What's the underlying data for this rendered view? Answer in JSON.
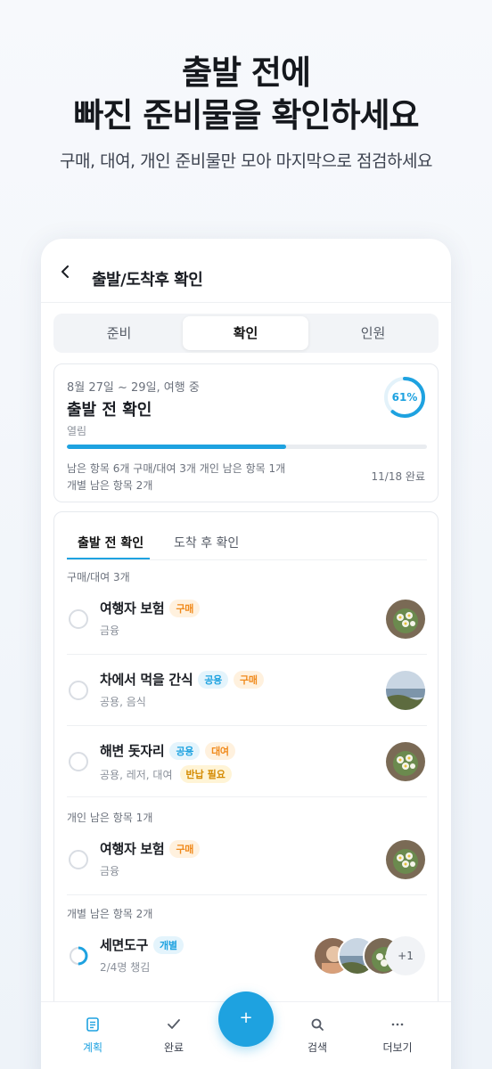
{
  "hero": {
    "title_line1": "출발 전에",
    "title_line2": "빠진 준비물을 확인하세요",
    "subtitle": "구매, 대여, 개인 준비물만 모아 마지막으로 점검하세요"
  },
  "header": {
    "title": "출발/도착후 확인",
    "back_icon": "chevron-left-icon"
  },
  "segments": {
    "items": [
      "준비",
      "확인",
      "인원"
    ],
    "active": "확인"
  },
  "summary": {
    "dates": "8월 27일 ~ 29일, 여행 중",
    "title": "출발 전 확인",
    "status": "열림",
    "progress_label": "61%",
    "progress": 0.61,
    "meta_line1": "남은 항목 6개  구매/대여 3개  개인 남은 항목 1개",
    "meta_line2": "개별 남은 항목 2개",
    "done": "11/18 완료"
  },
  "subtabs": [
    "출발 전 확인",
    "도착 후 확인"
  ],
  "sections": [
    {
      "label": "구매/대여 3개"
    },
    {
      "label": "개인 남은 항목 1개"
    },
    {
      "label": "개별 남은 항목 2개"
    }
  ],
  "items": [
    {
      "name": "여행자 보험",
      "tags": [
        "구매"
      ],
      "sub": "금융",
      "sub_tag": ""
    },
    {
      "name": "차에서 먹을 간식",
      "tags": [
        "공용",
        "구매"
      ],
      "sub": "공용, 음식",
      "sub_tag": ""
    },
    {
      "name": "해변 돗자리",
      "tags": [
        "공용",
        "대여"
      ],
      "sub": "공용, 레저, 대여",
      "sub_tag": "반납 필요"
    },
    {
      "name": "여행자 보험",
      "tags": [
        "구매"
      ],
      "sub": "금융",
      "sub_tag": ""
    },
    {
      "name": "세면도구",
      "tags": [
        "개별"
      ],
      "sub": "2/4명 챙김",
      "sub_tag": "",
      "extra_count": "+1",
      "progress": 0.5
    }
  ],
  "nav": {
    "items": [
      {
        "label": "계획",
        "icon": "document-icon"
      },
      {
        "label": "완료",
        "icon": "check-icon"
      },
      {
        "label": "검색",
        "icon": "search-icon"
      },
      {
        "label": "더보기",
        "icon": "more-icon"
      }
    ],
    "fab": "+",
    "active": "계획"
  },
  "colors": {
    "accent": "#1ea2e0",
    "orange": "#f08a1c",
    "text": "#1b1e24"
  }
}
